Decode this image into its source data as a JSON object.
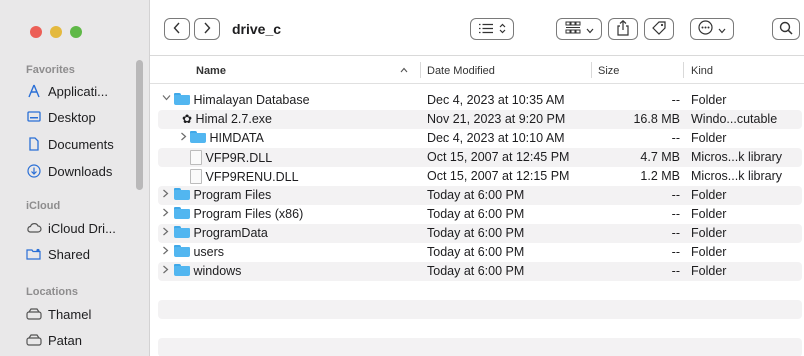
{
  "window": {
    "title": "drive_c"
  },
  "sidebar": {
    "sections": [
      {
        "label": "Favorites",
        "items": [
          {
            "label": "Applicati...",
            "icon": "applications-icon"
          },
          {
            "label": "Desktop",
            "icon": "desktop-icon"
          },
          {
            "label": "Documents",
            "icon": "documents-icon"
          },
          {
            "label": "Downloads",
            "icon": "downloads-icon"
          }
        ]
      },
      {
        "label": "iCloud",
        "items": [
          {
            "label": "iCloud Dri...",
            "icon": "icloud-icon"
          },
          {
            "label": "Shared",
            "icon": "shared-folder-icon"
          }
        ]
      },
      {
        "label": "Locations",
        "items": [
          {
            "label": "Thamel",
            "icon": "drive-icon"
          },
          {
            "label": "Patan",
            "icon": "drive-icon"
          }
        ]
      }
    ]
  },
  "columns": {
    "name": "Name",
    "date": "Date Modified",
    "size": "Size",
    "kind": "Kind"
  },
  "rows": [
    {
      "name": "Himalayan Database",
      "date": "Dec 4, 2023 at 10:35 AM",
      "size": "--",
      "kind": "Folder",
      "type": "folder",
      "level": 0,
      "expanded": true
    },
    {
      "name": "Himal 2.7.exe",
      "date": "Nov 21, 2023 at 9:20 PM",
      "size": "16.8 MB",
      "kind": "Windo...cutable",
      "type": "exe",
      "level": 1
    },
    {
      "name": "HIMDATA",
      "date": "Dec 4, 2023 at 10:10 AM",
      "size": "--",
      "kind": "Folder",
      "type": "folder",
      "level": 1,
      "expanded": false
    },
    {
      "name": "VFP9R.DLL",
      "date": "Oct 15, 2007 at 12:45 PM",
      "size": "4.7 MB",
      "kind": "Micros...k library",
      "type": "doc",
      "level": 1
    },
    {
      "name": "VFP9RENU.DLL",
      "date": "Oct 15, 2007 at 12:15 PM",
      "size": "1.2 MB",
      "kind": "Micros...k library",
      "type": "doc",
      "level": 1
    },
    {
      "name": "Program Files",
      "date": "Today at 6:00 PM",
      "size": "--",
      "kind": "Folder",
      "type": "folder",
      "level": 0,
      "expanded": false
    },
    {
      "name": "Program Files (x86)",
      "date": "Today at 6:00 PM",
      "size": "--",
      "kind": "Folder",
      "type": "folder",
      "level": 0,
      "expanded": false
    },
    {
      "name": "ProgramData",
      "date": "Today at 6:00 PM",
      "size": "--",
      "kind": "Folder",
      "type": "folder",
      "level": 0,
      "expanded": false
    },
    {
      "name": "users",
      "date": "Today at 6:00 PM",
      "size": "--",
      "kind": "Folder",
      "type": "folder",
      "level": 0,
      "expanded": false
    },
    {
      "name": "windows",
      "date": "Today at 6:00 PM",
      "size": "--",
      "kind": "Folder",
      "type": "folder",
      "level": 0,
      "expanded": false
    }
  ],
  "icons": {
    "back": "chevron-left-icon",
    "forward": "chevron-right-icon",
    "list_view": "list-view-icon",
    "group": "group-icon",
    "share": "share-icon",
    "tag": "tag-icon",
    "more": "ellipsis-circle-icon",
    "search": "search-icon"
  }
}
